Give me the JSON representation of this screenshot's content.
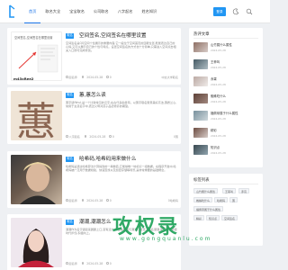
{
  "header": {
    "nav": [
      "首页",
      "取名大全",
      "宝宝取名",
      "公司取名",
      "八字起名",
      "姓名知识"
    ],
    "login_label": "登录",
    "brand_color": "#2196f3"
  },
  "posts": [
    {
      "tag": "取名",
      "title": "空间签名,空间签名在哪里设置",
      "excerpt": "空间签名是QQ空间个性展示的重要内容,它一般位于空间首页的显眼位置,既能表达自己的心情,又可以展示自己的个性与特点。设置空间签名的方式也十分简单,只需进入空间点击相关入口即可完成修改。",
      "thumb_caption": "空间签名,空间签名在哪里设置",
      "thumb_sub": "m43xRee2",
      "author": "起名师",
      "date": "2024-05-28",
      "views": "0",
      "right": "中文大学取名"
    },
    {
      "tag": "取名",
      "title": "蕙,蕙怎么读",
      "excerpt": "蕙字读作huì,是一个比较常见的汉字,在古代多指香草。以蕙字取名寓意美好高洁,蕙质兰心,常用于女孩名字中,表达父母对孩子品德修养的期望。",
      "thumb_char": "蕙",
      "author": "八字起名",
      "date": "2024-05-28",
      "views": "0",
      "right": "0蕙"
    },
    {
      "tag": "取名",
      "title": "哈希码,哈希码用来做什么",
      "excerpt": "哈希码是通过哈希算法计算得到的一串数值,它能够唯一地标识一组数据。在程序开发中,哈希码被广泛用于数据校验、快速查找以及加密存储等场景,是非常重要的基础概念。",
      "author": "起名师",
      "date": "2024-05-28",
      "views": "0",
      "right": "0哈希码"
    },
    {
      "tag": "取名",
      "title": "潮潮,潮潮怎么",
      "excerpt": "潮潮作为名字读起来朗朗上口,富有活力,象征着时尚与潮流。给孩子取名潮潮,寓意孩子紧跟时代步伐,积极向上。",
      "author": "起名师",
      "date": "2024-05-28",
      "views": "0",
      "right": ""
    }
  ],
  "sidebar": {
    "hot_title": "热评文章",
    "hot_items": [
      {
        "title": "山竹属什么属性",
        "date": "2024-05-28"
      },
      {
        "title": "王菲叫",
        "date": "2024-05-28"
      },
      {
        "title": "赤霄",
        "date": "2024-05-28"
      },
      {
        "title": "蜘蛛吃什么",
        "date": "2024-05-28"
      },
      {
        "title": "福佩帝属于什么属性",
        "date": "2024-05-28"
      },
      {
        "title": "精彩 ",
        "date": "2024-05-28"
      },
      {
        "title": "知识点",
        "date": "2024-05-28"
      }
    ],
    "tags_title": "标签列表",
    "tags": [
      "山竹属什么属性",
      "王菲叫",
      "赤霄",
      "蜘蛛吃什么",
      "福佩帝属于什么属性",
      "精彩",
      "知识点",
      "哈希码",
      "蕙",
      "空间签名"
    ]
  },
  "watermark": {
    "main": "攻权录",
    "sub": "www.gongquanlu.com"
  }
}
